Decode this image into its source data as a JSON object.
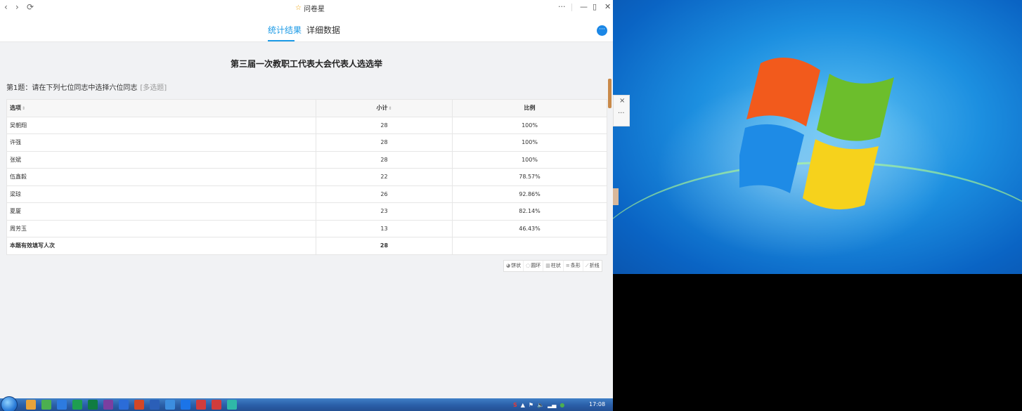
{
  "window": {
    "title": "问卷星",
    "back_glyph": "‹",
    "forward_glyph": "›",
    "refresh_glyph": "⟳",
    "more_glyph": "···",
    "minimize_glyph": "—",
    "restore_glyph": "▯",
    "close_glyph": "✕"
  },
  "tabs": [
    {
      "label": "统计结果",
      "active": true
    },
    {
      "label": "详细数据",
      "active": false
    }
  ],
  "menu_button_glyph": "···",
  "survey": {
    "title": "第三届一次教职工代表大会代表人选选举",
    "question": "第1题：请在下列七位同志中选择六位同志",
    "question_type": "[多选题]"
  },
  "table": {
    "headers": [
      "选项",
      "小计",
      "比例"
    ],
    "sort_glyph": "⇕",
    "rows": [
      {
        "name": "吴朝翔",
        "count": "28",
        "ratio": "100%"
      },
      {
        "name": "许强",
        "count": "28",
        "ratio": "100%"
      },
      {
        "name": "张斌",
        "count": "28",
        "ratio": "100%"
      },
      {
        "name": "伍鑫毅",
        "count": "22",
        "ratio": "78.57%"
      },
      {
        "name": "梁琼",
        "count": "26",
        "ratio": "92.86%"
      },
      {
        "name": "夏厦",
        "count": "23",
        "ratio": "82.14%"
      },
      {
        "name": "周芳玉",
        "count": "13",
        "ratio": "46.43%"
      }
    ],
    "total_label": "本题有效填写人次",
    "total_count": "28"
  },
  "chart_buttons": [
    {
      "label": "饼状",
      "icon": "pie-icon",
      "glyph": "◕"
    },
    {
      "label": "圆环",
      "icon": "donut-icon",
      "glyph": "◌"
    },
    {
      "label": "柱状",
      "icon": "column-icon",
      "glyph": "▥"
    },
    {
      "label": "条形",
      "icon": "bar-icon",
      "glyph": "≡"
    },
    {
      "label": "折线",
      "icon": "line-icon",
      "glyph": "⟋"
    }
  ],
  "side_panel": {
    "close_glyph": "×",
    "more_glyph": "···"
  },
  "taskbar": {
    "clock": "17:08",
    "icon_colors": [
      "#e8a23a",
      "#4caf50",
      "#2d7be0",
      "#1e9e50",
      "#107c41",
      "#7b3fa0",
      "#2b6cd8",
      "#d24726",
      "#2b5fb8",
      "#3c8ee0",
      "#1b74e8",
      "#d03c3c",
      "#d03c3c",
      "#2fb8a8"
    ]
  },
  "colors": {
    "accent": "#1b9ae6",
    "star": "#f0a000"
  }
}
